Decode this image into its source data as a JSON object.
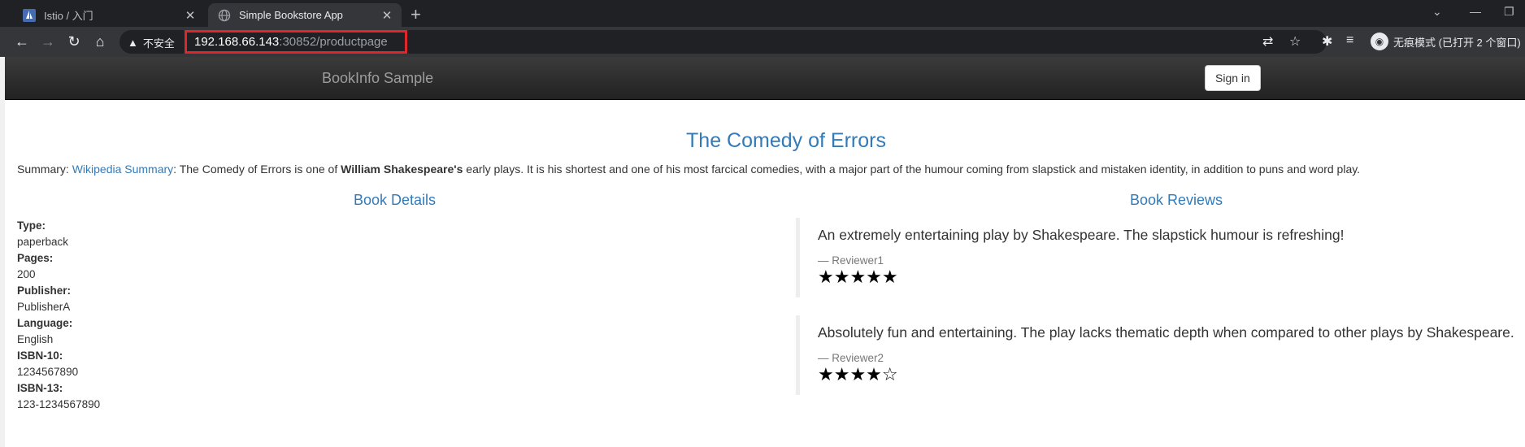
{
  "browser": {
    "tabs": [
      {
        "title": "Istio / 入门",
        "active": false
      },
      {
        "title": "Simple Bookstore App",
        "active": true
      }
    ],
    "security_label": "不安全",
    "url_host": "192.168.66.143",
    "url_path": ":30852/productpage",
    "profile_label": "无痕模式 (已打开 2 个窗口)"
  },
  "navbar": {
    "brand": "BookInfo Sample",
    "signin_label": "Sign in"
  },
  "book": {
    "title": "The Comedy of Errors",
    "summary_prefix": "Summary: ",
    "summary_link": "Wikipedia Summary",
    "summary_text_1": ": The Comedy of Errors is one of ",
    "summary_bold": "William Shakespeare's",
    "summary_text_2": " early plays. It is his shortest and one of his most farcical comedies, with a major part of the humour coming from slapstick and mistaken identity, in addition to puns and word play."
  },
  "details": {
    "heading": "Book Details",
    "fields": [
      {
        "label": "Type:",
        "value": "paperback"
      },
      {
        "label": "Pages:",
        "value": "200"
      },
      {
        "label": "Publisher:",
        "value": "PublisherA"
      },
      {
        "label": "Language:",
        "value": "English"
      },
      {
        "label": "ISBN-10:",
        "value": "1234567890"
      },
      {
        "label": "ISBN-13:",
        "value": "123-1234567890"
      }
    ]
  },
  "reviews": {
    "heading": "Book Reviews",
    "items": [
      {
        "text": "An extremely entertaining play by Shakespeare. The slapstick humour is refreshing!",
        "reviewer": "— Reviewer1",
        "stars": "★★★★★",
        "rating": 5
      },
      {
        "text": "Absolutely fun and entertaining. The play lacks thematic depth when compared to other plays by Shakespeare.",
        "reviewer": "— Reviewer2",
        "stars": "★★★★☆",
        "rating": 4
      }
    ]
  },
  "colors": {
    "accent": "#337ab7",
    "chrome_dark": "#202124",
    "url_highlight": "#e0262b"
  }
}
